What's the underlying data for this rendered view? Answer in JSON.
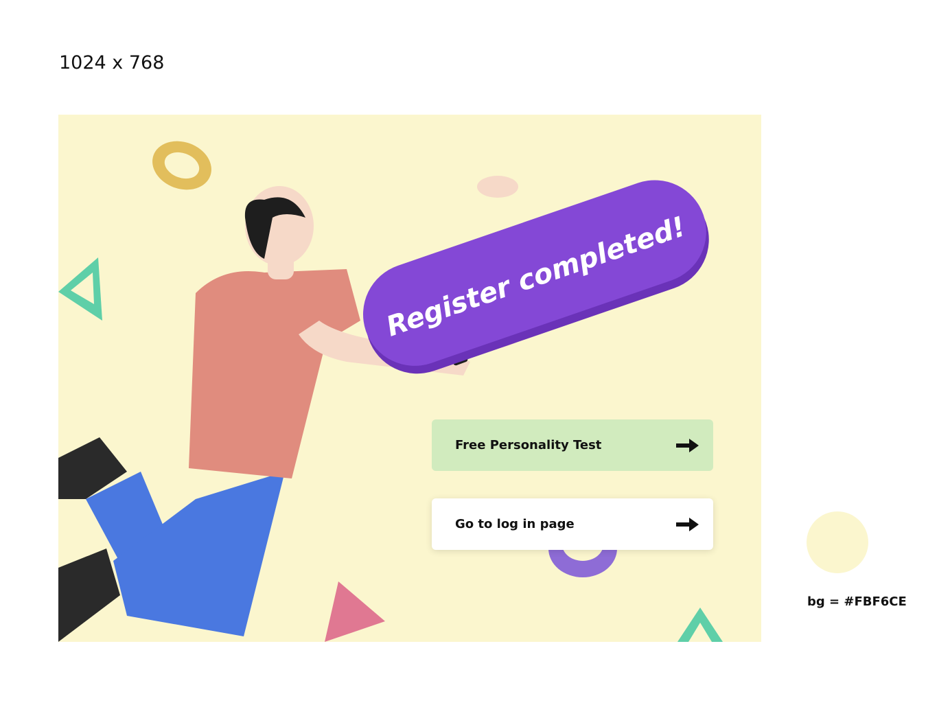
{
  "size_label": "1024 x 768",
  "colors": {
    "background": "#FBF6CE",
    "banner": "#8448D6",
    "test_button": "#D1EBBE",
    "login_button": "#FFFFFF",
    "shirt": "#E08C7E",
    "pants": "#4A78E0",
    "skin": "#F6D9C8",
    "hair": "#1E1E1E",
    "shoes": "#2A2A2A",
    "ring_gold": "#E2BE5C",
    "ring_purple": "#8E6CD6",
    "triangle_green": "#5FCFA8",
    "triangle_pink": "#E07892"
  },
  "banner": {
    "text": "Register completed!"
  },
  "buttons": {
    "test": {
      "label": "Free Personality Test",
      "icon": "arrow-right-icon"
    },
    "login": {
      "label": "Go to log in page",
      "icon": "arrow-right-icon"
    }
  },
  "swatch": {
    "label": "bg = #FBF6CE"
  }
}
